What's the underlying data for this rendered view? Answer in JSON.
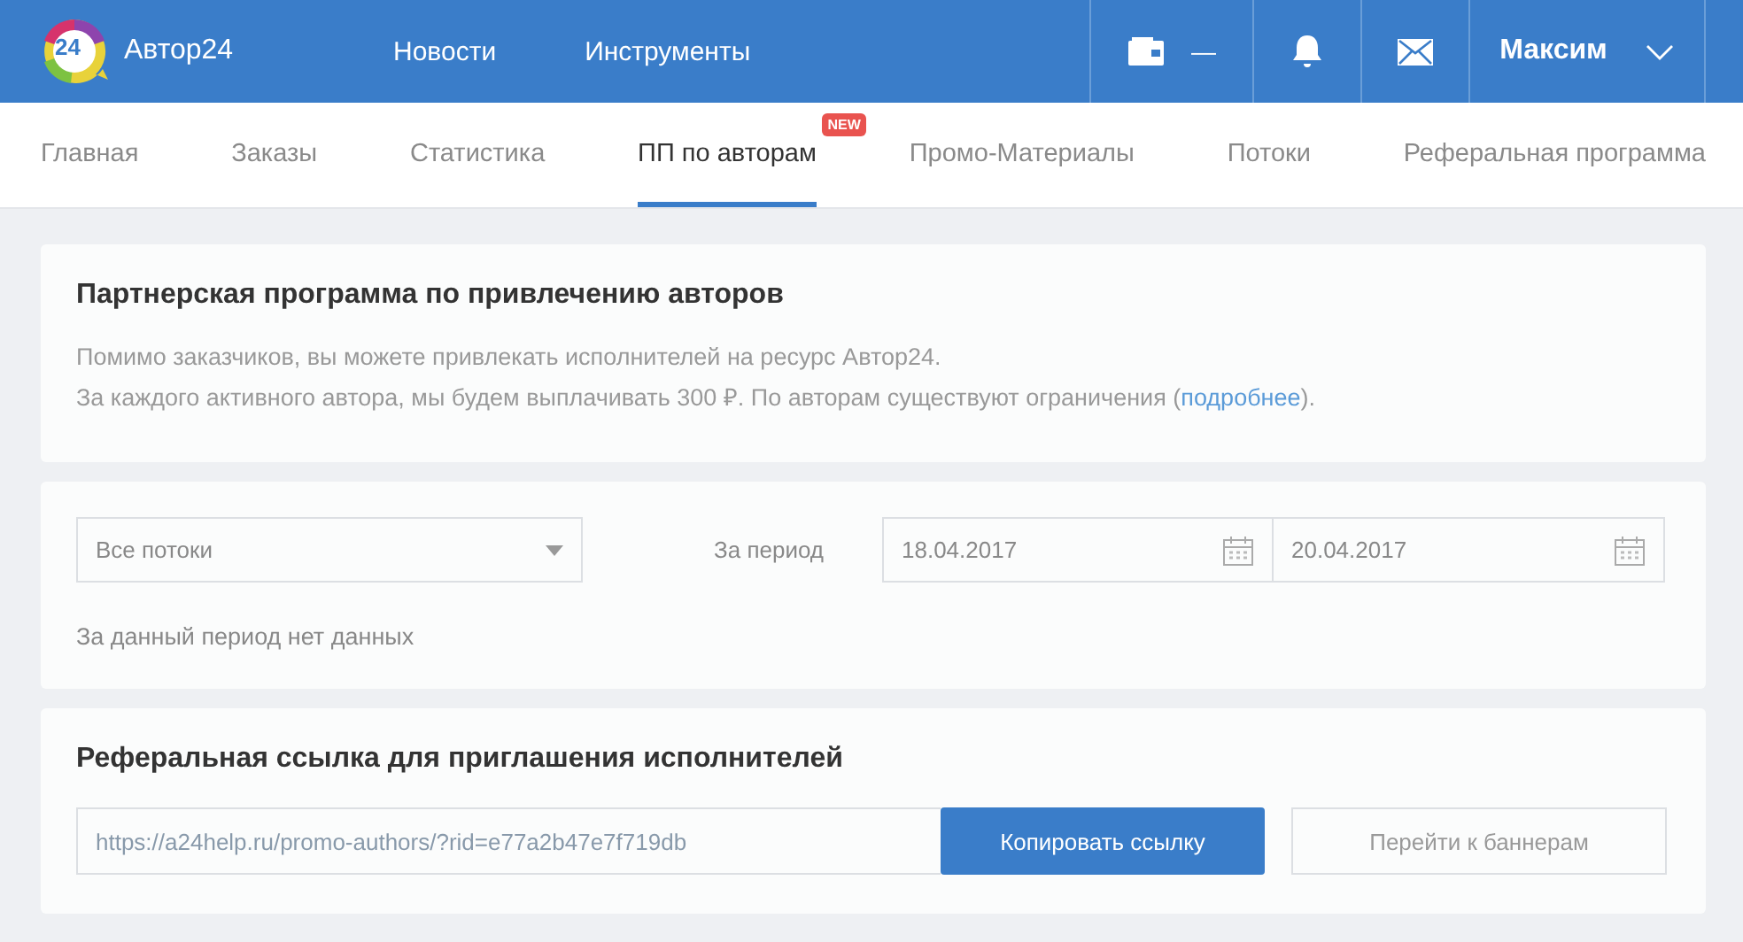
{
  "header": {
    "logo_badge": "24",
    "brand": "Автор24",
    "nav": [
      {
        "label": "Новости"
      },
      {
        "label": "Инструменты"
      }
    ],
    "balance": "—",
    "user": "Максим"
  },
  "tabs": [
    {
      "label": "Главная",
      "selected": false
    },
    {
      "label": "Заказы",
      "selected": false
    },
    {
      "label": "Статистика",
      "selected": false
    },
    {
      "label": "ПП по авторам",
      "selected": true,
      "badge": "NEW"
    },
    {
      "label": "Промо-Материалы",
      "selected": false
    },
    {
      "label": "Потоки",
      "selected": false
    },
    {
      "label": "Реферальная программа",
      "selected": false
    }
  ],
  "intro": {
    "title": "Партнерская программа по привлечению авторов",
    "line_1": "Помимо заказчиков, вы можете привлекать исполнителей на ресурс Автор24.",
    "line_2_before": "За каждого активного автора, мы будем выплачивать 300 ₽. По авторам существуют ограничения (",
    "line_2_link": "подробнее",
    "line_2_after": ")."
  },
  "filter": {
    "stream_select": "Все потоки",
    "period_label": "За период",
    "date_from": "18.04.2017",
    "date_to": "20.04.2017",
    "empty_message": "За данный период нет данных"
  },
  "referral": {
    "title": "Реферальная ссылка для приглашения исполнителей",
    "link": "https://a24help.ru/promo-authors/?rid=e77a2b47e7f719db",
    "copy_button": "Копировать ссылку",
    "banners_button": "Перейти к баннерам"
  }
}
